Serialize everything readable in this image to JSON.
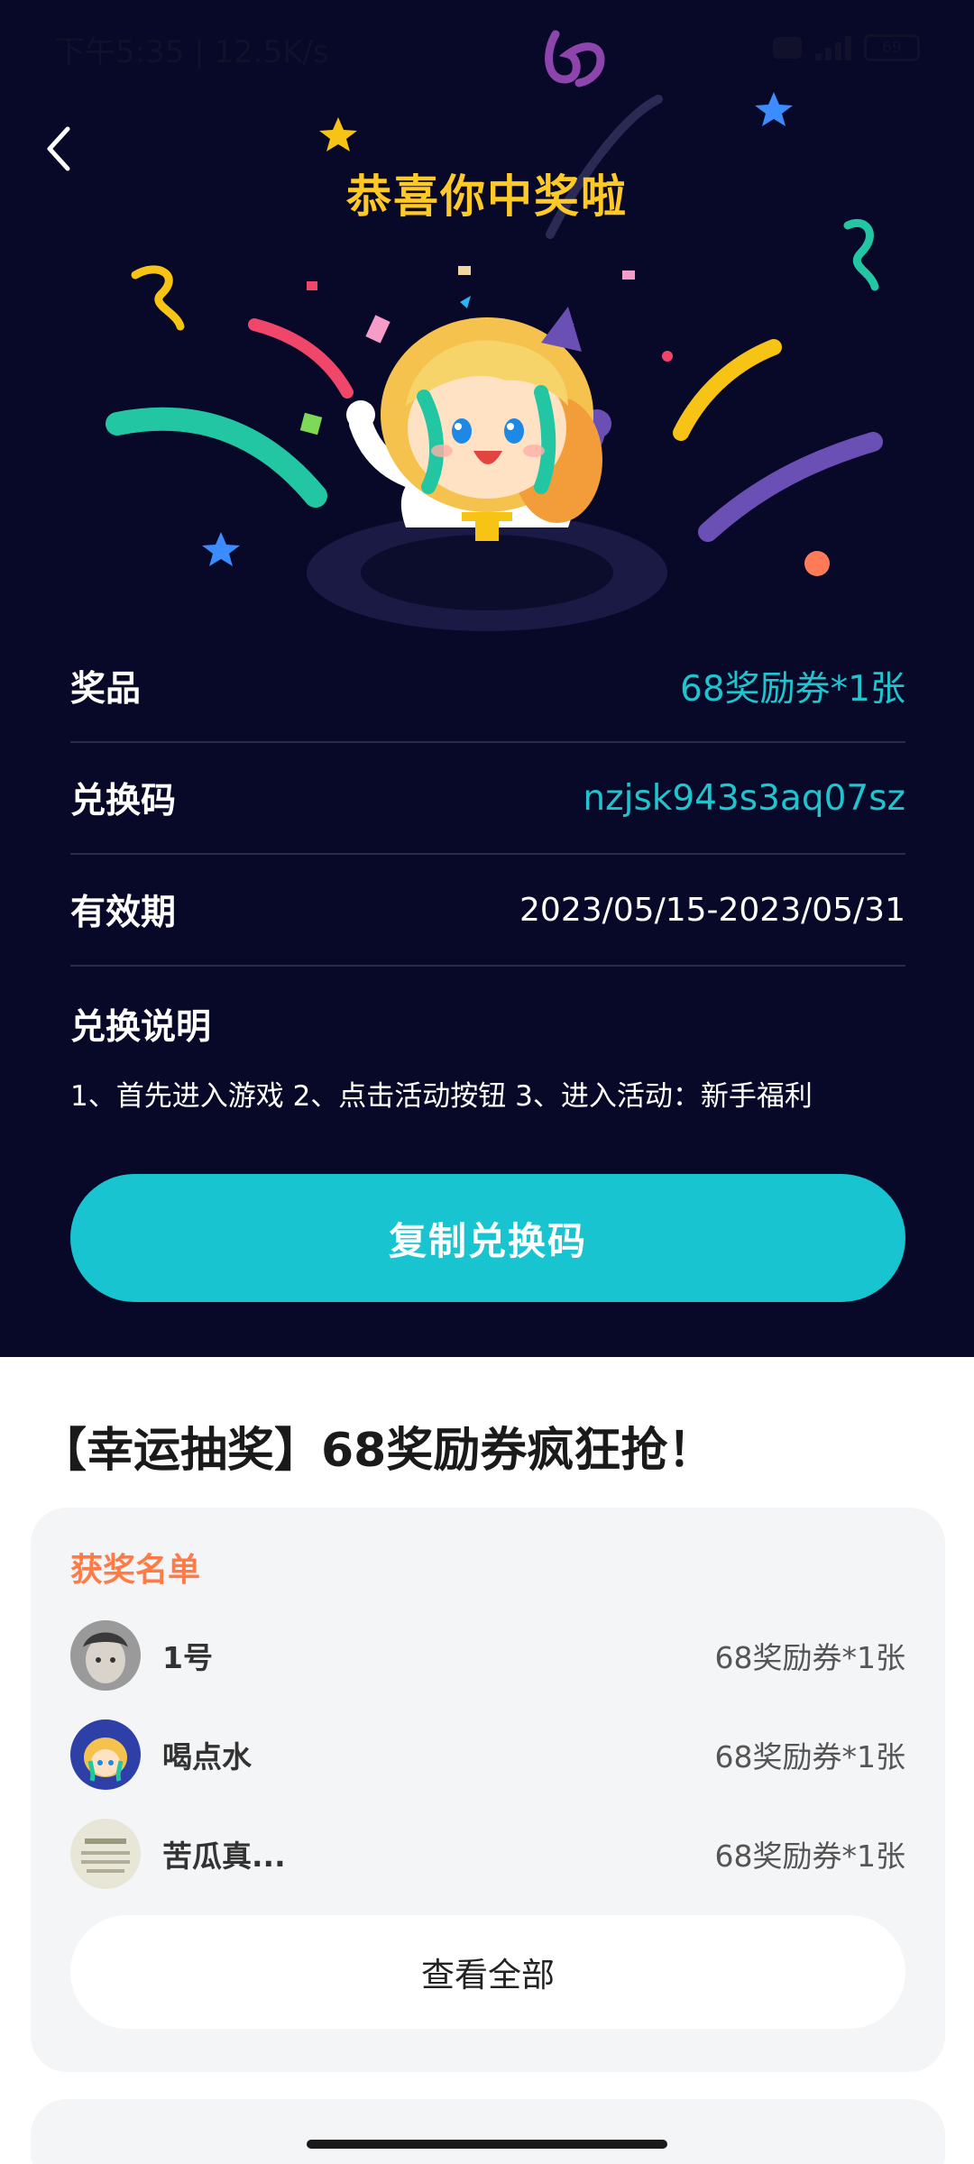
{
  "status_bar": {
    "time": "下午5:35 | 12.5K/s",
    "battery": "69"
  },
  "hero": {
    "title": "恭喜你中奖啦"
  },
  "prize_info": {
    "prize_label": "奖品",
    "prize_value": "68奖励券*1张",
    "code_label": "兑换码",
    "code_value": "nzjsk943s3aq07sz",
    "validity_label": "有效期",
    "validity_value": "2023/05/15-2023/05/31",
    "instructions_label": "兑换说明",
    "instructions_text": "1、首先进入游戏 2、点击活动按钮 3、进入活动：新手福利"
  },
  "copy_button": {
    "label": "复制兑换码"
  },
  "event": {
    "title": "【幸运抽奖】68奖励券疯狂抢！"
  },
  "winners": {
    "title": "获奖名单",
    "items": [
      {
        "name": "1号",
        "prize": "68奖励券*1张"
      },
      {
        "name": "喝点水",
        "prize": "68奖励券*1张"
      },
      {
        "name": "苦瓜真...",
        "prize": "68奖励券*1张"
      }
    ],
    "view_all_label": "查看全部"
  },
  "colors": {
    "hero_bg": "#080828",
    "title_gold": "#FFC927",
    "accent_cyan": "#17C4CF",
    "winners_title": "#FF7A45"
  },
  "icons": {
    "back": "chevron-left-icon",
    "alarm": "alarm-icon",
    "signal": "signal-icon",
    "battery": "battery-icon"
  }
}
